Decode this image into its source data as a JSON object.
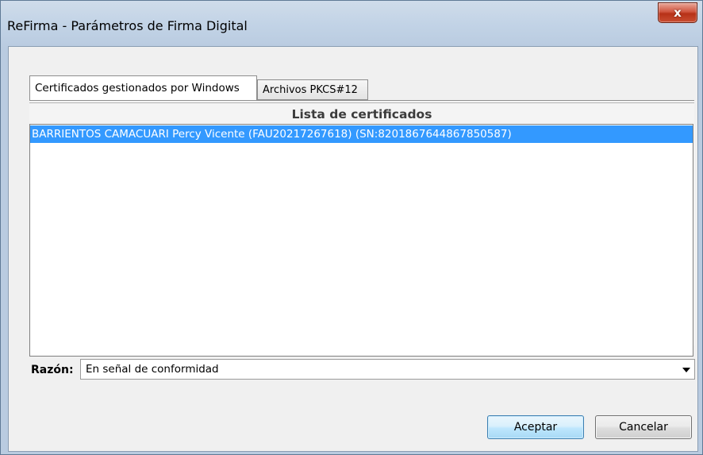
{
  "window": {
    "title": "ReFirma - Parámetros de Firma Digital",
    "close_label": "x"
  },
  "tabs": [
    {
      "label": "Certificados gestionados por Windows",
      "active": true
    },
    {
      "label": "Archivos PKCS#12",
      "active": false
    }
  ],
  "certificates": {
    "title": "Lista de certificados",
    "items": [
      {
        "label": "BARRIENTOS CAMACUARI Percy Vicente (FAU20217267618) (SN:8201867644867850587)",
        "selected": true
      }
    ]
  },
  "reason": {
    "label": "Razón:",
    "value": "En señal de conformidad"
  },
  "buttons": {
    "accept": "Aceptar",
    "cancel": "Cancelar"
  }
}
